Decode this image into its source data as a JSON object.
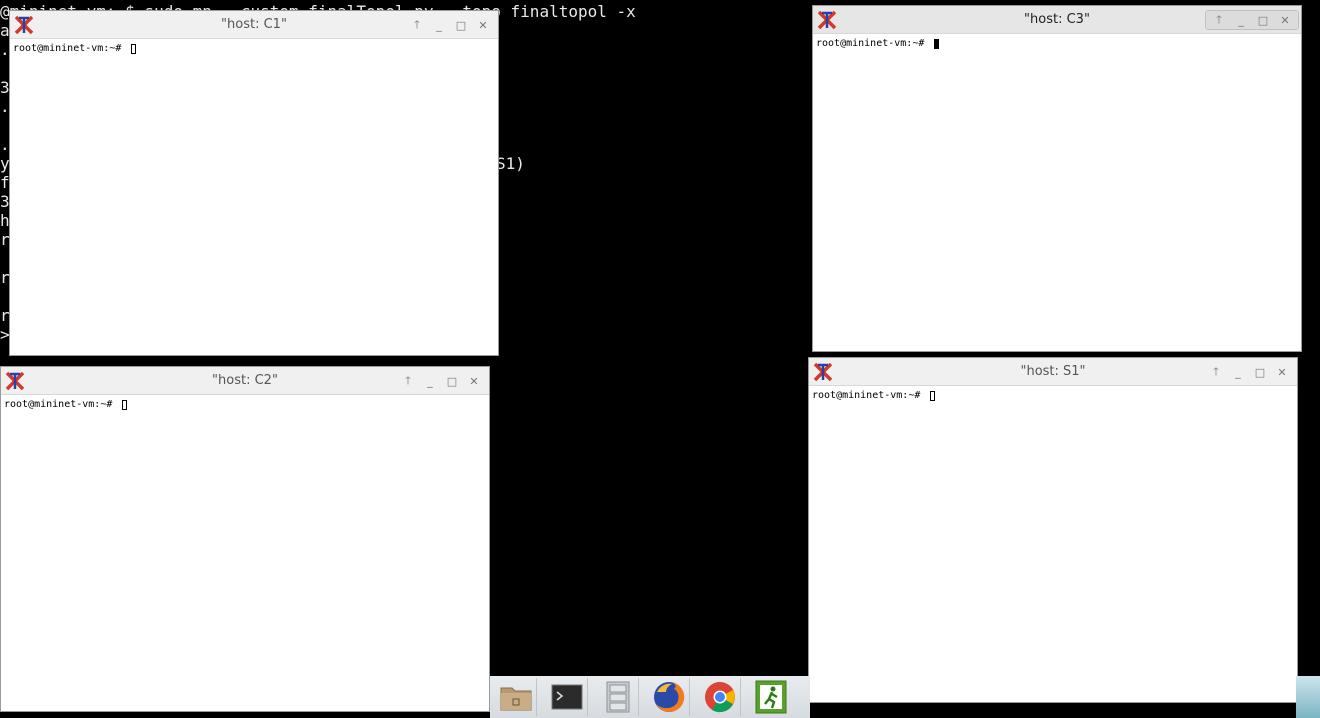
{
  "background_terminal": {
    "command_line": "@mininet-vm:~$ sudo mn --custom finalTopol.py --topo finaltopol -x",
    "fragment_s1": "S1)",
    "left_chars": [
      "at",
      ".n",
      "3",
      ".n",
      ".n",
      "y",
      "fi",
      "3",
      "hi",
      "rt",
      "rt",
      "rt",
      ">"
    ]
  },
  "windows": {
    "c1": {
      "title": "\"host: C1\"",
      "prompt": "root@mininet-vm:~# "
    },
    "c2": {
      "title": "\"host: C2\"",
      "prompt": "root@mininet-vm:~# "
    },
    "c3": {
      "title": "\"host: C3\"",
      "prompt": "root@mininet-vm:~# "
    },
    "s1": {
      "title": "\"host: S1\"",
      "prompt": "root@mininet-vm:~# "
    }
  },
  "title_buttons": {
    "up": "🡑",
    "minimize": "_",
    "maximize": "□",
    "close": "✕"
  },
  "taskbar": {
    "items": [
      "file-manager",
      "terminal",
      "file-cabinet",
      "firefox",
      "chrome",
      "logout"
    ]
  },
  "colors": {
    "xterm_red": "#d03a2a",
    "xterm_blue": "#2a3fa8"
  }
}
